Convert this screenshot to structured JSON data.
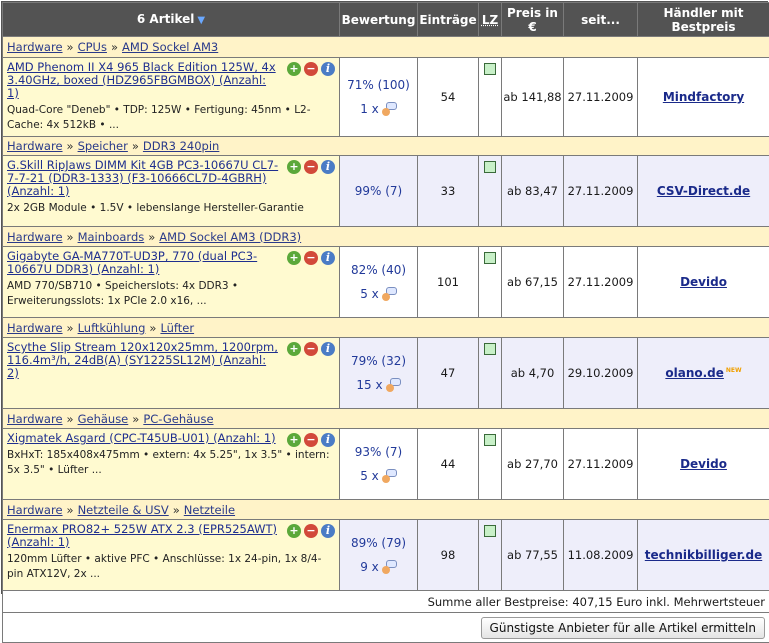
{
  "header": {
    "articles": "6 Artikel",
    "rating": "Bewertung",
    "entries": "Einträge",
    "lz": "LZ",
    "price": "Preis in €",
    "since": "seit...",
    "dealer": "Händler mit Bestpreis"
  },
  "rows": [
    {
      "breadcrumb": [
        "Hardware",
        "CPUs",
        "AMD Sockel AM3"
      ],
      "name": "AMD Phenom II X4 965 Black Edition 125W, 4x 3.40GHz, boxed (HDZ965FBGMBOX) (Anzahl: 1)",
      "desc": "Quad-Core \"Deneb\" • TDP: 125W • Fertigung: 45nm • L2-Cache: 4x 512kB • ...",
      "rating": "71% (100)",
      "count": "1 x",
      "entries": "54",
      "price": "ab 141,88",
      "since": "27.11.2009",
      "dealer": "Mindfactory"
    },
    {
      "breadcrumb": [
        "Hardware",
        "Speicher",
        "DDR3 240pin"
      ],
      "name": "G.Skill RipJaws DIMM Kit 4GB PC3-10667U CL7-7-7-21 (DDR3-1333) (F3-10666CL7D-4GBRH) (Anzahl: 1)",
      "desc": "2x 2GB Module • 1.5V • lebenslange Hersteller-Garantie",
      "rating": "99% (7)",
      "count": "",
      "entries": "33",
      "price": "ab 83,47",
      "since": "27.11.2009",
      "dealer": "CSV-Direct.de"
    },
    {
      "breadcrumb": [
        "Hardware",
        "Mainboards",
        "AMD Sockel AM3 (DDR3)"
      ],
      "name": "Gigabyte GA-MA770T-UD3P, 770 (dual PC3-10667U DDR3) (Anzahl: 1)",
      "desc": "AMD 770/SB710 • Speicherslots: 4x DDR3 • Erweiterungsslots: 1x PCIe 2.0 x16, ...",
      "rating": "82% (40)",
      "count": "5 x",
      "entries": "101",
      "price": "ab 67,15",
      "since": "27.11.2009",
      "dealer": "Devido"
    },
    {
      "breadcrumb": [
        "Hardware",
        "Luftkühlung",
        "Lüfter"
      ],
      "name": "Scythe Slip Stream 120x120x25mm, 1200rpm, 116.4m³/h, 24dB(A) (SY1225SL12M) (Anzahl: 2)",
      "desc": "",
      "rating": "79% (32)",
      "count": "15 x",
      "entries": "47",
      "price": "ab 4,70",
      "since": "29.10.2009",
      "dealer": "olano.de"
    },
    {
      "breadcrumb": [
        "Hardware",
        "Gehäuse",
        "PC-Gehäuse"
      ],
      "name": "Xigmatek Asgard (CPC-T45UB-U01) (Anzahl: 1)",
      "desc": "BxHxT: 185x408x475mm • extern: 4x 5.25\", 1x 3.5\" • intern: 5x 3.5\" • Lüfter ...",
      "rating": "93% (7)",
      "count": "5 x",
      "entries": "44",
      "price": "ab 27,70",
      "since": "27.11.2009",
      "dealer": "Devido"
    },
    {
      "breadcrumb": [
        "Hardware",
        "Netzteile & USV",
        "Netzteile"
      ],
      "name": "Enermax PRO82+ 525W ATX 2.3 (EPR525AWT) (Anzahl: 1)",
      "desc": "120mm Lüfter • aktive PFC • Anschlüsse: 1x 24-pin, 1x 8/4-pin ATX12V, 2x ...",
      "rating": "89% (79)",
      "count": "9 x",
      "entries": "98",
      "price": "ab 77,55",
      "since": "11.08.2009",
      "dealer": "technikbilliger.de"
    }
  ],
  "sum": "Summe aller Bestpreise: 407,15 Euro inkl. Mehrwertsteuer",
  "button": "Günstigste Anbieter für alle Artikel ermitteln",
  "icons": {
    "add": "plus-icon",
    "remove": "minus-icon",
    "info": "info-icon",
    "review": "speech-bubble-icon",
    "sort": "sort-down-icon"
  },
  "colors": {
    "header": "#535353",
    "category": "#fff3c8",
    "name_cell": "#fffad0",
    "alt_row": "#eeeefa",
    "link": "#1f2f8f"
  }
}
